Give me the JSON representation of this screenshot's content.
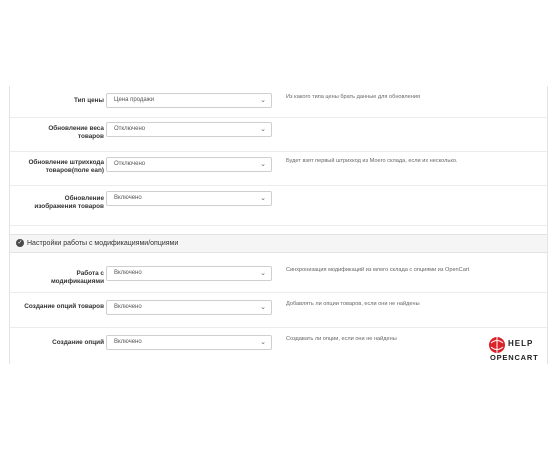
{
  "rows_top": [
    {
      "label": "Тип цены",
      "value": "Цена продажи",
      "help": "Из какого типа цены брать данные для обновления"
    },
    {
      "label": "Обновление веса товаров",
      "value": "Отключено",
      "help": ""
    },
    {
      "label": "Обновление штрихкода товаров(поле ean)",
      "value": "Отключено",
      "help": "Будет взят первый штрихкод из Моего склада, если их несколько."
    },
    {
      "label": "Обновление изображения товаров",
      "value": "Включено",
      "help": ""
    }
  ],
  "section": {
    "title": "Настройки работы с модификациями/опциями",
    "icon": "check-circle-icon"
  },
  "rows_bottom": [
    {
      "label": "Работа с модификациями",
      "value": "Включено",
      "help": "Синхронизация модификаций из млего склада с опциями из OpenCart"
    },
    {
      "label": "Создание опций товаров",
      "value": "Включено",
      "help": "Добавлять ли опции товаров, если они не найдены"
    },
    {
      "label": "Создание опций",
      "value": "Включено",
      "help": "Создавать ли опции, если они не найдены"
    }
  ],
  "watermark": {
    "line1": "HELP",
    "line2": "OPENCART"
  },
  "colors": {
    "section_bg": "#f5f5f5",
    "border": "#e3e3e3",
    "logo_red": "#d9222a"
  }
}
